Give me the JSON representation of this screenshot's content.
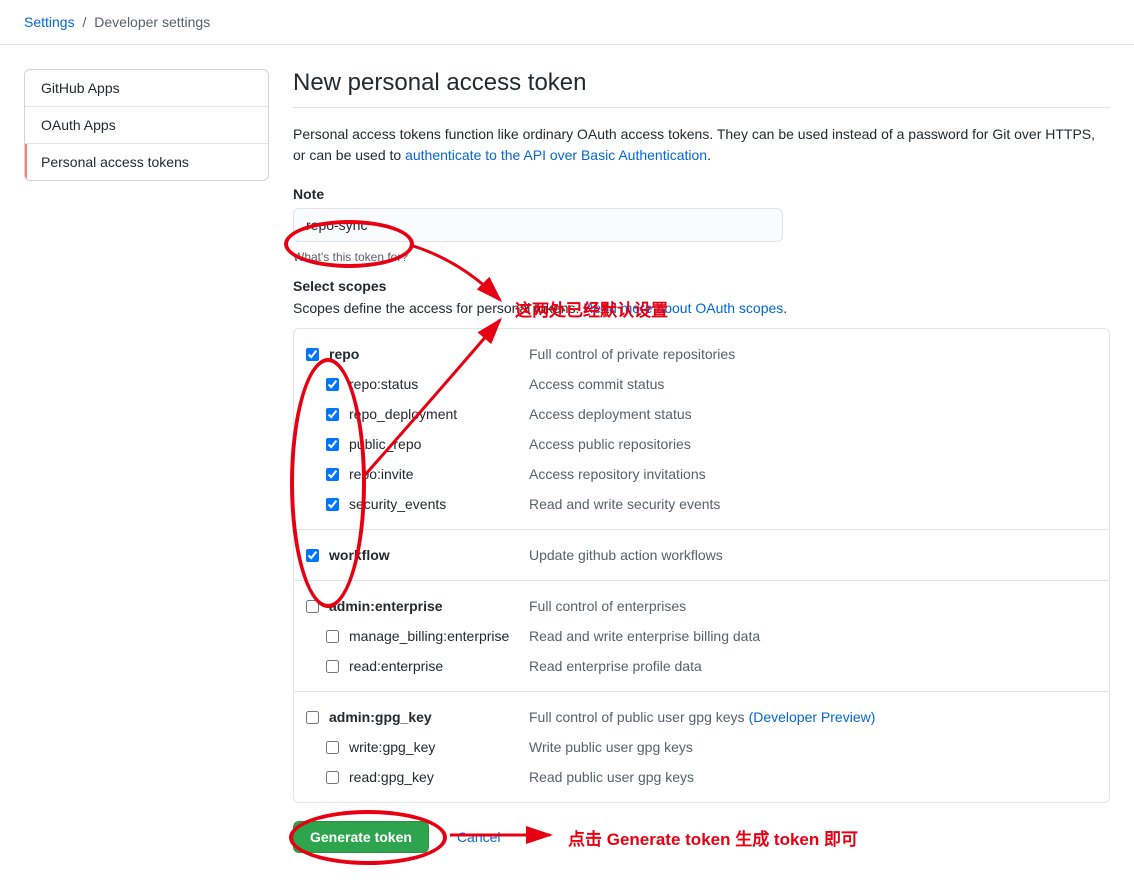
{
  "breadcrumb": {
    "settings": "Settings",
    "sep": "/",
    "current": "Developer settings"
  },
  "sidebar": {
    "items": [
      {
        "label": "GitHub Apps",
        "selected": false
      },
      {
        "label": "OAuth Apps",
        "selected": false
      },
      {
        "label": "Personal access tokens",
        "selected": true
      }
    ]
  },
  "page": {
    "title": "New personal access token",
    "intro_pre": "Personal access tokens function like ordinary OAuth access tokens. They can be used instead of a password for Git over HTTPS, or can be used to ",
    "intro_link": "authenticate to the API over Basic Authentication",
    "intro_post": "."
  },
  "note": {
    "label": "Note",
    "value": "repo-sync",
    "help": "What's this token for?"
  },
  "scopes": {
    "header": "Select scopes",
    "define_pre": "Scopes define the access for personal tokens. ",
    "define_link": "Read more about OAuth scopes",
    "define_post": ".",
    "groups": [
      {
        "name": "repo",
        "desc": "Full control of private repositories",
        "checked": true,
        "children": [
          {
            "name": "repo:status",
            "desc": "Access commit status",
            "checked": true
          },
          {
            "name": "repo_deployment",
            "desc": "Access deployment status",
            "checked": true
          },
          {
            "name": "public_repo",
            "desc": "Access public repositories",
            "checked": true
          },
          {
            "name": "repo:invite",
            "desc": "Access repository invitations",
            "checked": true
          },
          {
            "name": "security_events",
            "desc": "Read and write security events",
            "checked": true
          }
        ]
      },
      {
        "name": "workflow",
        "desc": "Update github action workflows",
        "checked": true,
        "children": []
      },
      {
        "name": "admin:enterprise",
        "desc": "Full control of enterprises",
        "checked": false,
        "children": [
          {
            "name": "manage_billing:enterprise",
            "desc": "Read and write enterprise billing data",
            "checked": false
          },
          {
            "name": "read:enterprise",
            "desc": "Read enterprise profile data",
            "checked": false
          }
        ]
      },
      {
        "name": "admin:gpg_key",
        "desc": "Full control of public user gpg keys",
        "dev_preview": "(Developer Preview)",
        "checked": false,
        "children": [
          {
            "name": "write:gpg_key",
            "desc": "Write public user gpg keys",
            "checked": false
          },
          {
            "name": "read:gpg_key",
            "desc": "Read public user gpg keys",
            "checked": false
          }
        ]
      }
    ]
  },
  "actions": {
    "generate": "Generate token",
    "cancel": "Cancel"
  },
  "annotations": {
    "text1": "这两处已经默认设置",
    "text2": "点击 Generate token 生成 token 即可"
  }
}
